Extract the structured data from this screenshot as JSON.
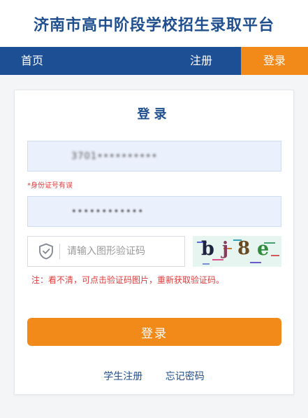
{
  "header": {
    "title": "济南市高中阶段学校招生录取平台"
  },
  "nav": {
    "home": "首页",
    "register": "注册",
    "login": "登录"
  },
  "login": {
    "title": "登录",
    "id_value": "3701••••••••••",
    "id_error": "*身份证号有误",
    "password_value": "••••••••••••",
    "captcha_placeholder": "请输入图形验证码",
    "captcha_text": [
      "b",
      "j",
      "8",
      "e"
    ],
    "captcha_hint": "注：看不清，可点击验证码图片，重新获取验证码。",
    "submit_label": "登录"
  },
  "links": {
    "student_register": "学生注册",
    "forgot_password": "忘记密码"
  },
  "colors": {
    "brand_blue": "#1d4f94",
    "accent_orange": "#f28a1a",
    "error_red": "#e03c3c"
  }
}
